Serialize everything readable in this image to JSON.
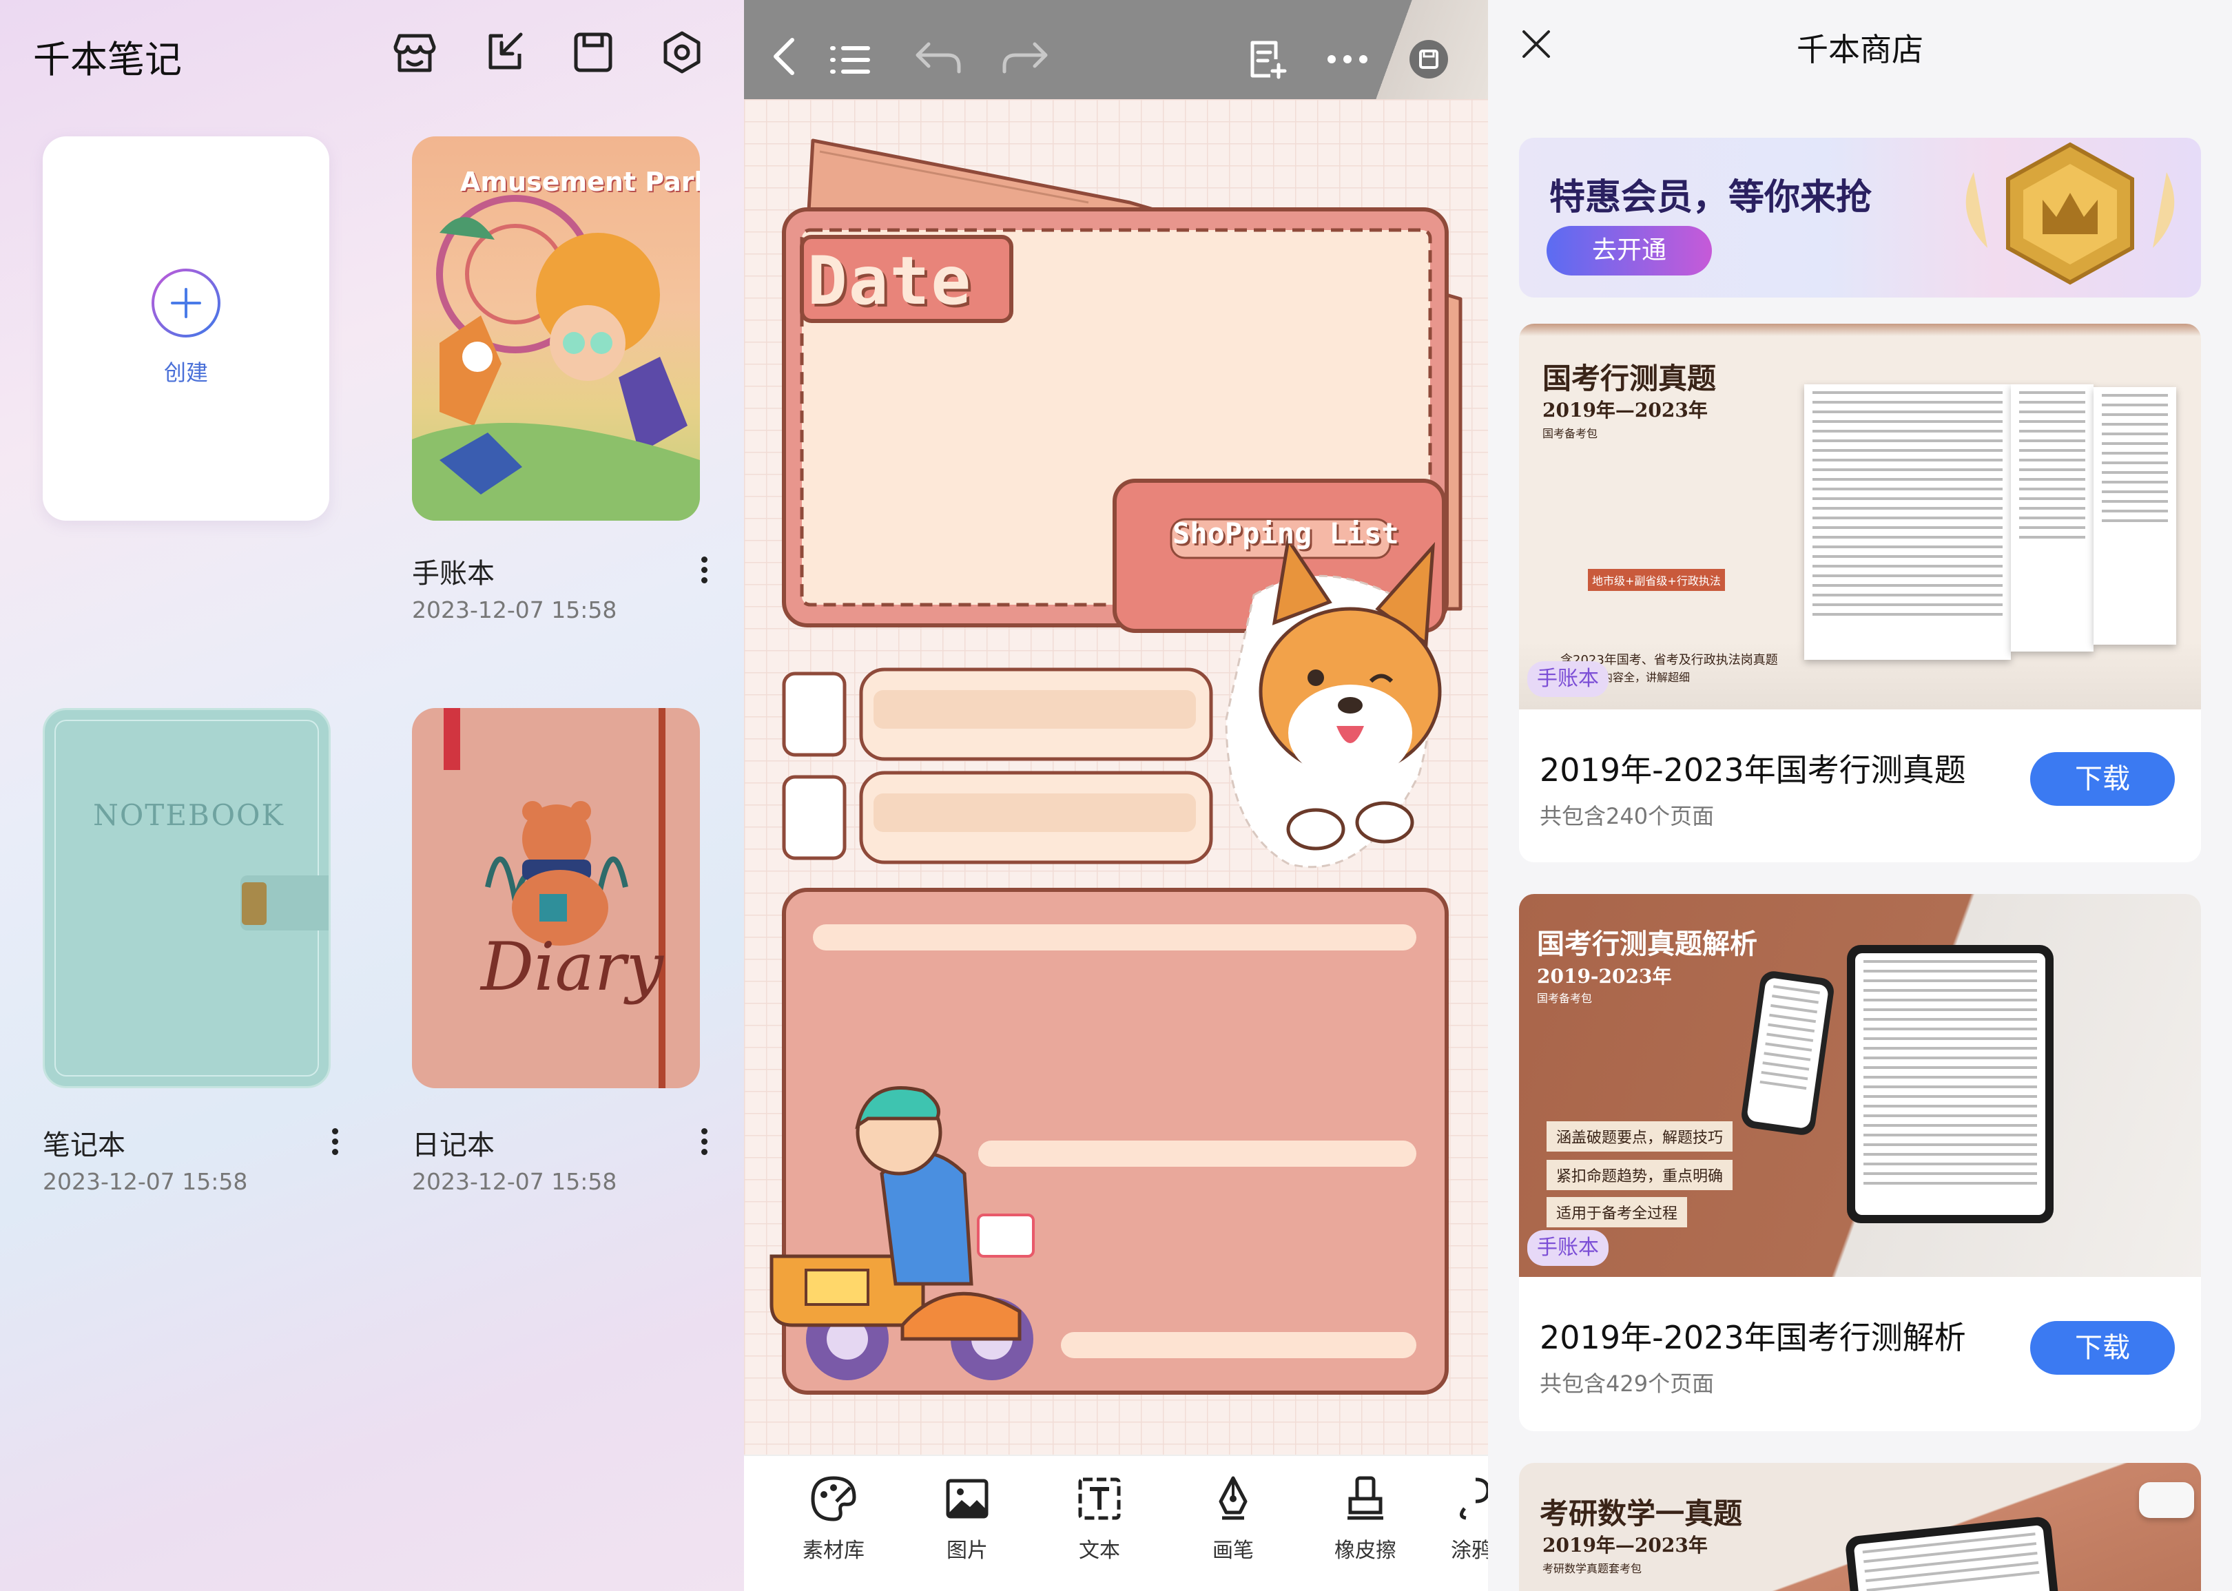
{
  "panel_library": {
    "title": "千本笔记",
    "toolbar_icons": [
      "store-icon",
      "import-icon",
      "save-icon",
      "settings-icon"
    ],
    "create_label": "创建",
    "notebooks": [
      {
        "name": "手账本",
        "date": "2023-12-07 15:58",
        "cover_title": "Amusement Park"
      },
      {
        "name": "笔记本",
        "date": "2023-12-07 15:58",
        "cover_title": "NOTEBOOK"
      },
      {
        "name": "日记本",
        "date": "2023-12-07 15:58",
        "cover_title": "Diary"
      }
    ]
  },
  "panel_editor": {
    "header_icons": [
      "back-icon",
      "outline-icon",
      "undo-icon",
      "redo-icon",
      "add-page-icon",
      "more-icon",
      "save-icon"
    ],
    "template": {
      "date_label": "Date",
      "shopping_label": "ShoPping List"
    },
    "tools": [
      {
        "label": "素材库",
        "icon": "palette-icon"
      },
      {
        "label": "图片",
        "icon": "image-icon"
      },
      {
        "label": "文本",
        "icon": "text-icon"
      },
      {
        "label": "画笔",
        "icon": "pen-icon"
      },
      {
        "label": "橡皮擦",
        "icon": "eraser-icon"
      },
      {
        "label": "涂鸦",
        "icon": "lasso-icon"
      }
    ]
  },
  "panel_store": {
    "title": "千本商店",
    "banner": {
      "text": "特惠会员，等你来抢",
      "button": "去开通"
    },
    "products": [
      {
        "cover_title": "国考行测真题",
        "cover_subtitle": "2019年—2023年",
        "cover_small": "国考备考包",
        "cover_badge": "地市级+副省级+行政执法",
        "cover_note1": "含2023年国考、省考及行政执法岗真题",
        "cover_note2": "内容全，讲解超细",
        "tag": "手账本",
        "title": "2019年-2023年国考行测真题",
        "pages": "共包含240个页面",
        "button": "下载"
      },
      {
        "cover_title": "国考行测真题解析",
        "cover_subtitle": "2019-2023年",
        "cover_small": "国考备考包",
        "cover_points": [
          "涵盖破题要点，解题技巧",
          "紧扣命题趋势，重点明确",
          "适用于备考全过程"
        ],
        "tag": "手账本",
        "title": "2019年-2023年国考行测解析",
        "pages": "共包含429个页面",
        "button": "下载"
      },
      {
        "cover_title": "考研数学一真题",
        "cover_subtitle": "2019年—2023年",
        "cover_small": "考研数学真题套考包"
      }
    ]
  }
}
